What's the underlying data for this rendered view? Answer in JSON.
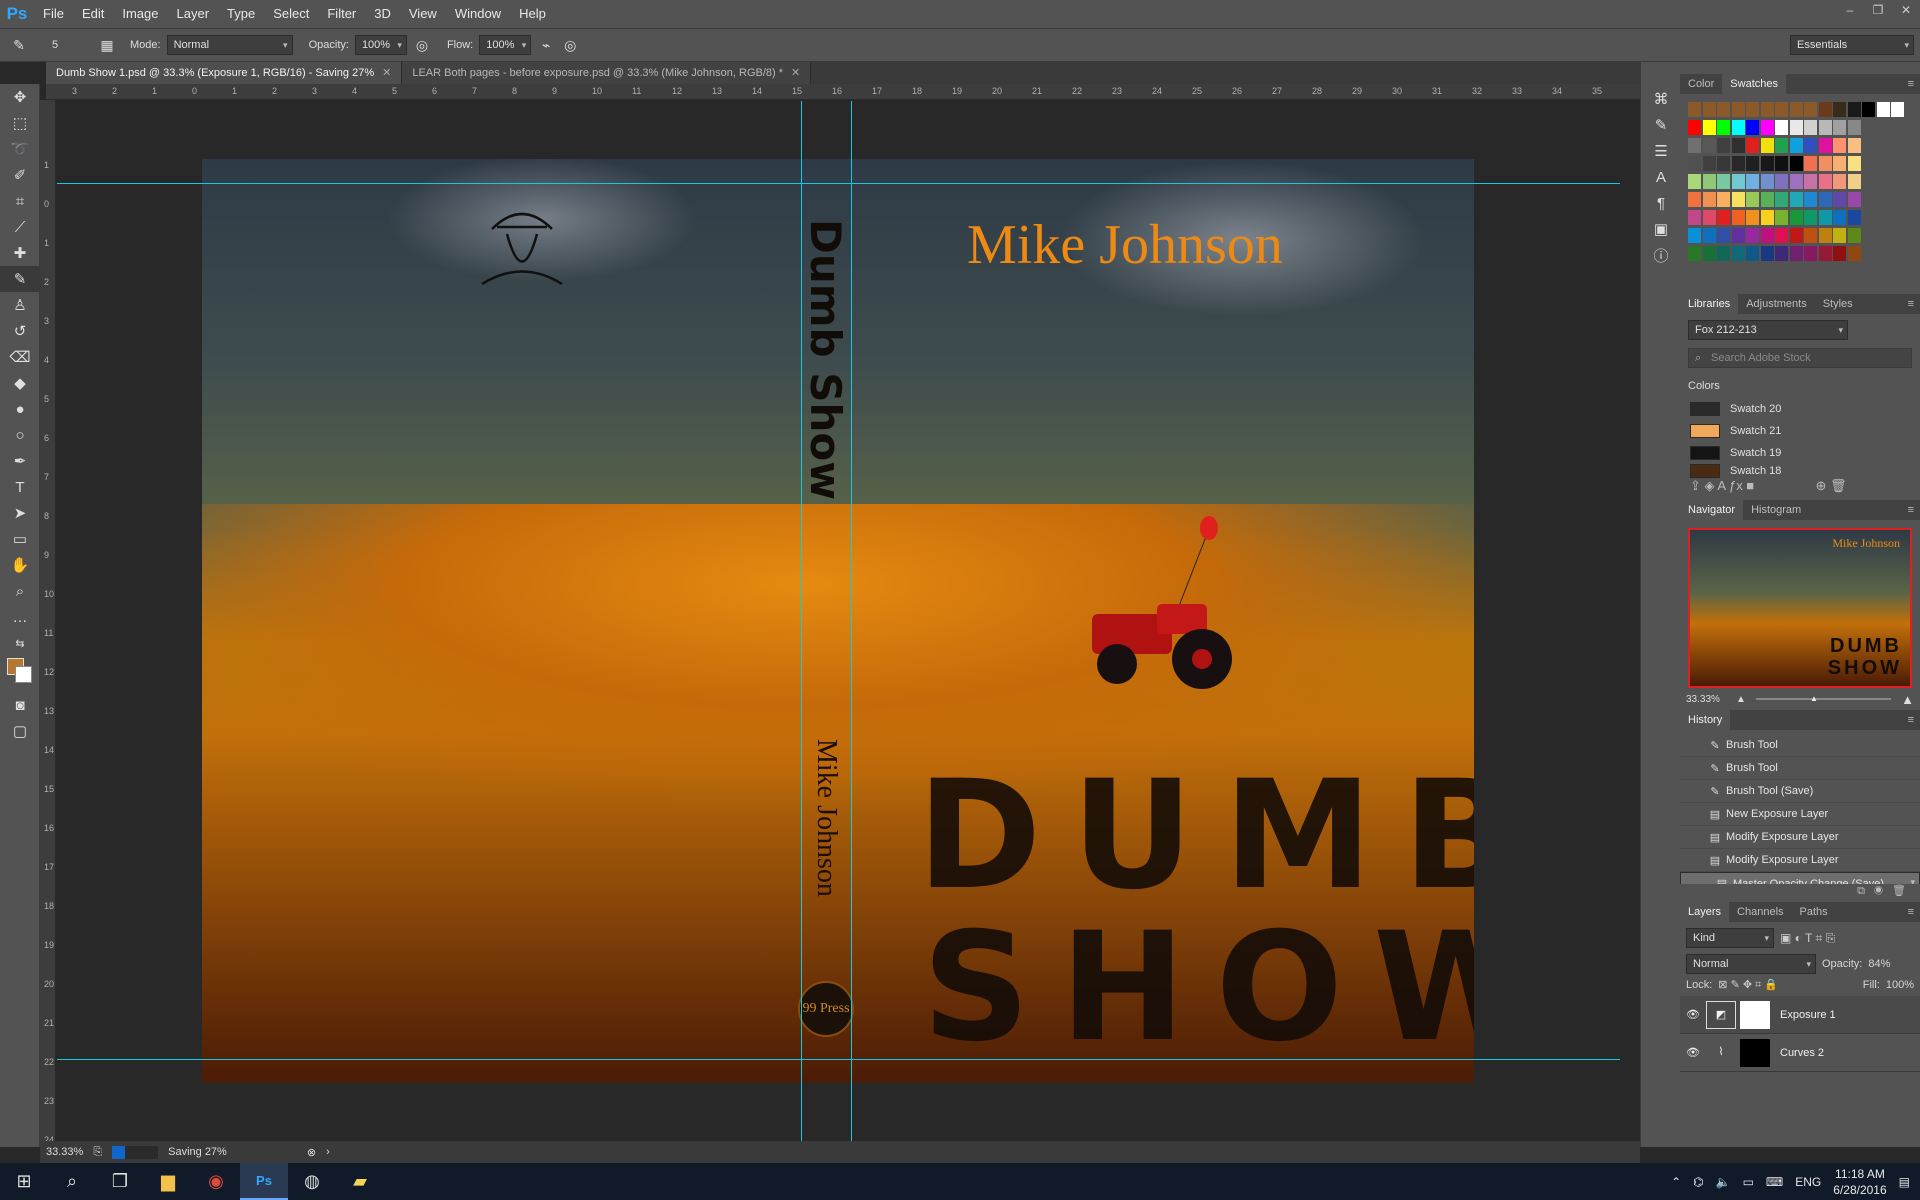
{
  "app": {
    "logo": "Ps"
  },
  "menu": [
    "File",
    "Edit",
    "Image",
    "Layer",
    "Type",
    "Select",
    "Filter",
    "3D",
    "View",
    "Window",
    "Help"
  ],
  "window_controls": [
    "–",
    "❐",
    "✕"
  ],
  "options": {
    "brush_size": "5",
    "mode_label": "Mode:",
    "mode_value": "Normal",
    "opacity_label": "Opacity:",
    "opacity_value": "100%",
    "flow_label": "Flow:",
    "flow_value": "100%",
    "workspace": "Essentials"
  },
  "tabs": [
    {
      "label": "Dumb Show 1.psd @ 33.3% (Exposure 1, RGB/16) - Saving 27%",
      "active": true
    },
    {
      "label": "LEAR Both pages - before exposure.psd @ 33.3% (Mike  Johnson, RGB/8) *",
      "active": false
    }
  ],
  "ruler_top": [
    "3",
    "2",
    "1",
    "0",
    "1",
    "2",
    "3",
    "4",
    "5",
    "6",
    "7",
    "8",
    "9",
    "10",
    "11",
    "12",
    "13",
    "14",
    "15",
    "16",
    "17",
    "18",
    "19",
    "20",
    "21",
    "22",
    "23",
    "24",
    "25",
    "26",
    "27",
    "28",
    "29",
    "30",
    "31",
    "32",
    "33",
    "34",
    "35"
  ],
  "ruler_left": [
    "1",
    "0",
    "1",
    "2",
    "3",
    "4",
    "5",
    "6",
    "7",
    "8",
    "9",
    "10",
    "11",
    "12",
    "13",
    "14",
    "15",
    "16",
    "17",
    "18",
    "19",
    "20",
    "21",
    "22",
    "23",
    "24"
  ],
  "cover": {
    "author": "Mike Johnson",
    "title_line1": "DUMB",
    "title_line2": "SHOW",
    "spine_title": "Dumb Show",
    "spine_author": "Mike Johnson",
    "press": "99 Press"
  },
  "swatches_panel": {
    "tabs": [
      "Color",
      "Swatches"
    ],
    "active": "Swatches"
  },
  "libraries_panel": {
    "tabs": [
      "Libraries",
      "Adjustments",
      "Styles"
    ],
    "library_name": "Fox 212-213",
    "search_placeholder": "Search Adobe Stock",
    "section": "Colors",
    "colors": [
      {
        "name": "Swatch 20",
        "color": "#2a2a2a"
      },
      {
        "name": "Swatch 21",
        "color": "#f0a85a"
      },
      {
        "name": "Swatch 19",
        "color": "#141414"
      },
      {
        "name": "Swatch 18",
        "color": "#4a2a10"
      }
    ]
  },
  "navigator_panel": {
    "tabs": [
      "Navigator",
      "Histogram"
    ],
    "zoom": "33.33%"
  },
  "history_panel": {
    "title": "History",
    "items": [
      "Brush Tool",
      "Brush Tool",
      "Brush Tool (Save)",
      "New Exposure Layer",
      "Modify Exposure Layer",
      "Modify Exposure Layer",
      "Master Opacity Change (Save)"
    ]
  },
  "layers_panel": {
    "tabs": [
      "Layers",
      "Channels",
      "Paths"
    ],
    "filter": "Kind",
    "blend_mode": "Normal",
    "opacity_label": "Opacity:",
    "opacity_value": "84%",
    "lock_label": "Lock:",
    "fill_label": "Fill:",
    "fill_value": "100%",
    "layers": [
      {
        "name": "Exposure 1",
        "selected": true
      },
      {
        "name": "Curves 2",
        "selected": false
      }
    ]
  },
  "status": {
    "zoom": "33.33%",
    "progress_text": "Saving 27%",
    "progress": 0.27
  },
  "taskbar": {
    "lang": "ENG",
    "time": "11:18 AM",
    "date": "6/28/2016"
  },
  "colors": {
    "accent": "#31a8ff",
    "guide": "#18c8e0",
    "author_orange": "#ee8a14"
  }
}
